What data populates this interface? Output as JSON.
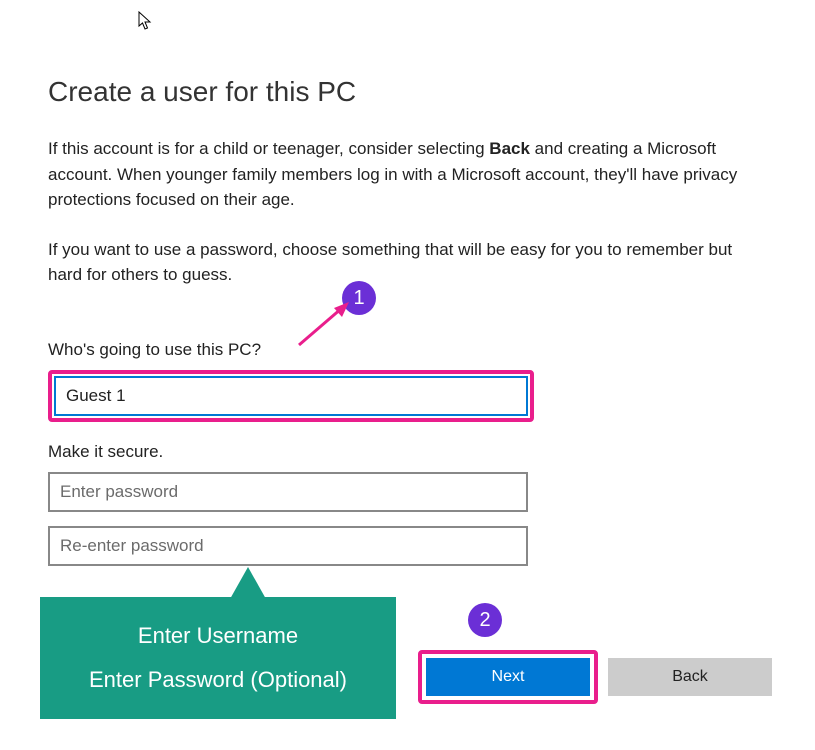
{
  "title": "Create a user for this PC",
  "intro": {
    "prefix": "If this account is for a child or teenager, consider selecting ",
    "bold": "Back",
    "suffix": " and creating a Microsoft account. When younger family members log in with a Microsoft account, they'll have privacy protections focused on their age."
  },
  "password_hint": "If you want to use a password, choose something that will be easy for you to remember but hard for others to guess.",
  "username_section": {
    "label": "Who's going to use this PC?",
    "value": "Guest 1"
  },
  "secure_section": {
    "label": "Make it secure.",
    "password_placeholder": "Enter password",
    "reenter_placeholder": "Re-enter password"
  },
  "callout": {
    "line1": "Enter Username",
    "line2": "Enter Password (Optional)"
  },
  "markers": {
    "one": "1",
    "two": "2"
  },
  "buttons": {
    "next": "Next",
    "back": "Back"
  }
}
